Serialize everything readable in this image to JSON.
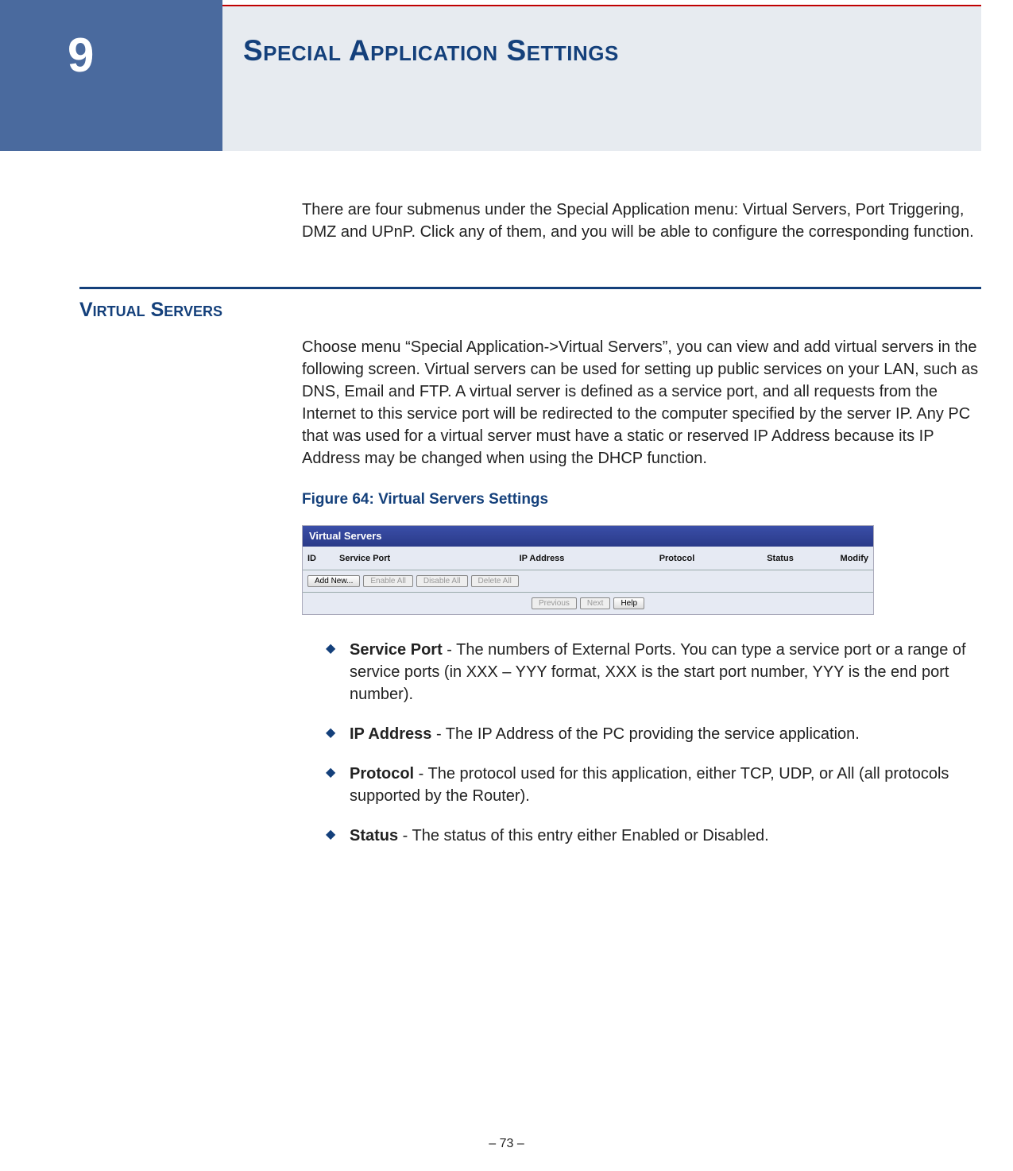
{
  "chapter": {
    "number": "9",
    "title": "Special Application Settings"
  },
  "intro": "There are four submenus under the Special Application menu: Virtual Servers, Port Triggering, DMZ and UPnP. Click any of them, and you will be able to configure the corresponding function.",
  "section": {
    "heading": "Virtual Servers",
    "body": "Choose menu “Special Application->Virtual Servers”, you can view and add virtual servers in the following screen. Virtual servers can be used for setting up public services on your LAN, such as DNS, Email and FTP. A virtual server is defined as a service port, and all requests from the Internet to this service port will be redirected to the computer specified by the server IP. Any PC that was used for a virtual server must have a static or reserved IP Address because its IP Address may be changed when using the DHCP function."
  },
  "figure": {
    "caption": "Figure 64:  Virtual Servers Settings",
    "panel_title": "Virtual Servers",
    "columns": {
      "id": "ID",
      "service_port": "Service Port",
      "ip_address": "IP Address",
      "protocol": "Protocol",
      "status": "Status",
      "modify": "Modify"
    },
    "buttons": {
      "add_new": "Add New...",
      "enable_all": "Enable All",
      "disable_all": "Disable All",
      "delete_all": "Delete All",
      "previous": "Previous",
      "next": "Next",
      "help": "Help"
    }
  },
  "bullets": [
    {
      "term": "Service Port",
      "text": " - The numbers of External Ports. You can type a service port or a range of service ports (in XXX – YYY format, XXX is the start port number, YYY is the end port number)."
    },
    {
      "term": "IP Address",
      "text": " - The IP Address of the PC providing the service application."
    },
    {
      "term": "Protocol",
      "text": " - The protocol used for this application, either TCP, UDP, or All (all protocols supported by the Router)."
    },
    {
      "term": "Status",
      "text": " - The status of this entry either Enabled or Disabled."
    }
  ],
  "page_number": "–  73  –"
}
